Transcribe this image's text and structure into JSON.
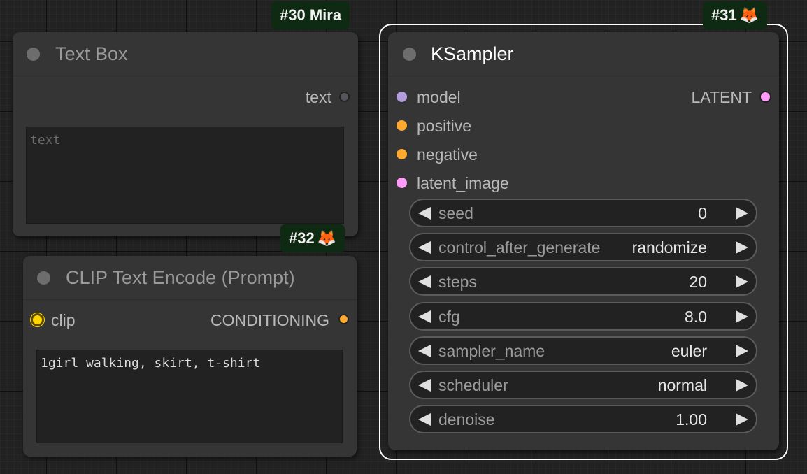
{
  "canvas": {
    "grid_color": "#222222"
  },
  "text_box_node": {
    "badge": "#30 Mira",
    "title": "Text Box",
    "output_label": "text",
    "output_color": "#8a8a96",
    "textarea_placeholder": "text",
    "textarea_value": ""
  },
  "clip_node": {
    "badge_id": "#32",
    "badge_emoji": "🦊",
    "title": "CLIP Text Encode (Prompt)",
    "input_label": "clip",
    "input_color": "#ffd500",
    "output_label": "CONDITIONING",
    "output_color": "#ffa931",
    "textarea_value": "1girl walking, skirt, t-shirt"
  },
  "ksampler_node": {
    "badge_id": "#31",
    "badge_emoji": "🦊",
    "title": "KSampler",
    "selected": true,
    "inputs": [
      {
        "label": "model",
        "color": "#b39ddb"
      },
      {
        "label": "positive",
        "color": "#ffa931"
      },
      {
        "label": "negative",
        "color": "#ffa931"
      },
      {
        "label": "latent_image",
        "color": "#ff9cf9"
      }
    ],
    "output_label": "LATENT",
    "output_color": "#ff9cf9",
    "widgets": [
      {
        "name": "seed",
        "value": "0"
      },
      {
        "name": "control_after_generate",
        "value": "randomize"
      },
      {
        "name": "steps",
        "value": "20"
      },
      {
        "name": "cfg",
        "value": "8.0"
      },
      {
        "name": "sampler_name",
        "value": "euler"
      },
      {
        "name": "scheduler",
        "value": "normal"
      },
      {
        "name": "denoise",
        "value": "1.00"
      }
    ]
  }
}
